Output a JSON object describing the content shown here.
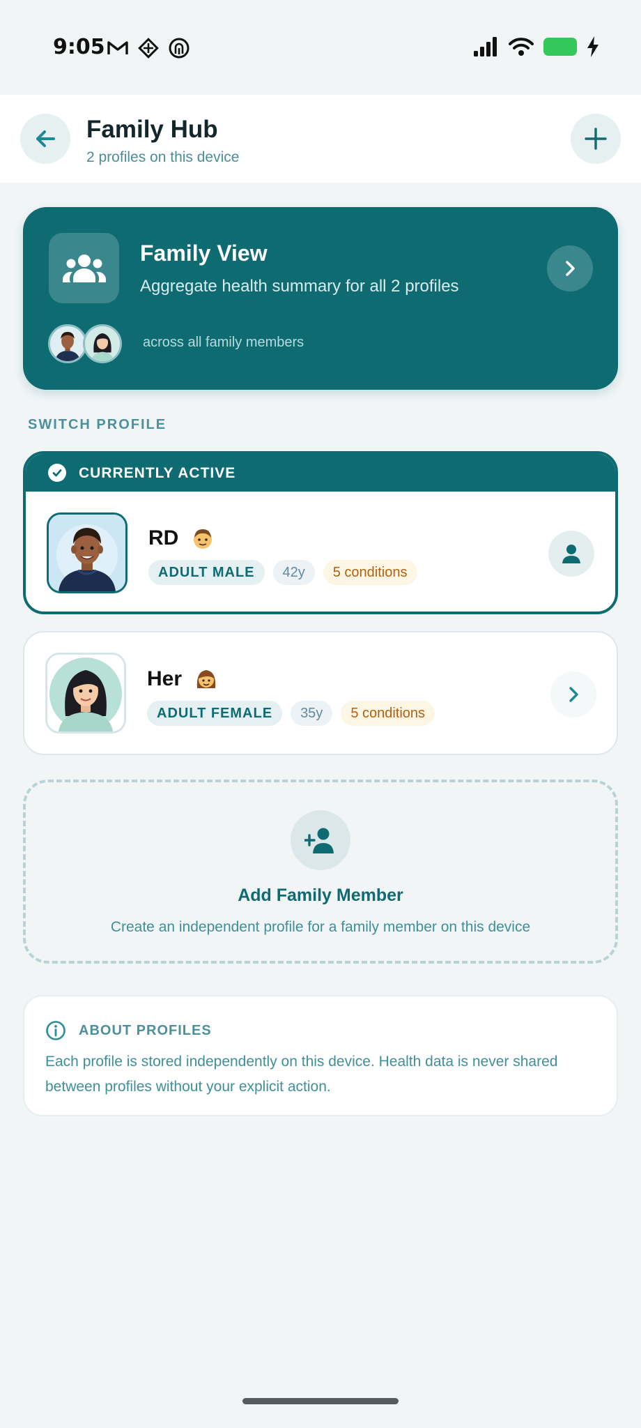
{
  "status_bar": {
    "time": "9:05",
    "left_icons": [
      "gmail-icon",
      "app-diamond-icon",
      "fingerprint-app-icon"
    ],
    "right_icons": [
      "cellular-signal-icon",
      "wifi-icon",
      "battery-charging-icon"
    ],
    "battery_color": "#34c759"
  },
  "header": {
    "title": "Family Hub",
    "subtitle": "2 profiles on this device",
    "back_icon": "arrow-left-icon",
    "add_icon": "plus-icon"
  },
  "family_view": {
    "title": "Family View",
    "description": "Aggregate health summary for all 2 profiles",
    "footnote": "across all family members",
    "icon": "group-icon",
    "background_color": "#0e6b72"
  },
  "switch_section": {
    "label": "SWITCH PROFILE"
  },
  "profiles": [
    {
      "active": true,
      "banner": "CURRENTLY ACTIVE",
      "name": "RD",
      "emoji": "👨",
      "type": "ADULT MALE",
      "age": "42y",
      "conditions": "5 conditions",
      "action_icon": "person-icon"
    },
    {
      "active": false,
      "name": "Her",
      "emoji": "👩",
      "type": "ADULT FEMALE",
      "age": "35y",
      "conditions": "5 conditions",
      "action_icon": "chevron-right-icon"
    }
  ],
  "add_member": {
    "title": "Add Family Member",
    "description": "Create an independent profile for a family member on this device",
    "icon": "person-add-icon"
  },
  "about": {
    "title": "ABOUT PROFILES",
    "text": "Each profile is stored independently on this device. Health data is never shared between profiles without your explicit action.",
    "icon": "info-icon"
  },
  "colors": {
    "primary": "#0e6b72",
    "accent_text": "#4b9199",
    "background": "#f1f5f6",
    "conditions_text": "#b4600f"
  }
}
